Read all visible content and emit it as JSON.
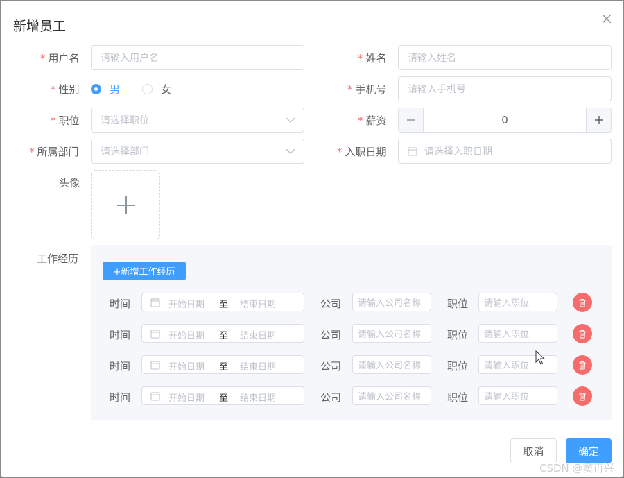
{
  "dialog": {
    "title": "新增员工"
  },
  "form": {
    "username": {
      "label": "用户名",
      "placeholder": "请输入用户名"
    },
    "name": {
      "label": "姓名",
      "placeholder": "请输入姓名"
    },
    "gender": {
      "label": "性别",
      "options": [
        "男",
        "女"
      ],
      "selected": "男"
    },
    "phone": {
      "label": "手机号",
      "placeholder": "请输入手机号"
    },
    "position": {
      "label": "职位",
      "placeholder": "请选择职位"
    },
    "salary": {
      "label": "薪资",
      "value": "0"
    },
    "department": {
      "label": "所属部门",
      "placeholder": "请选择部门"
    },
    "hire_date": {
      "label": "入职日期",
      "placeholder": "请选择入职日期"
    },
    "avatar": {
      "label": "头像"
    },
    "experience": {
      "label": "工作经历",
      "add_button": "+新增工作经历",
      "time_label": "时间",
      "start_placeholder": "开始日期",
      "range_separator": "至",
      "end_placeholder": "结束日期",
      "company_label": "公司",
      "company_placeholder": "请输入公司名称",
      "position_label": "职位",
      "position_placeholder": "请输入职位",
      "rows": [
        {},
        {},
        {},
        {}
      ]
    }
  },
  "footer": {
    "cancel": "取消",
    "confirm": "确定"
  },
  "watermark": "CSDN @窦再兴",
  "colors": {
    "primary": "#409eff",
    "danger": "#f56c6c",
    "required": "#f56c6c"
  }
}
